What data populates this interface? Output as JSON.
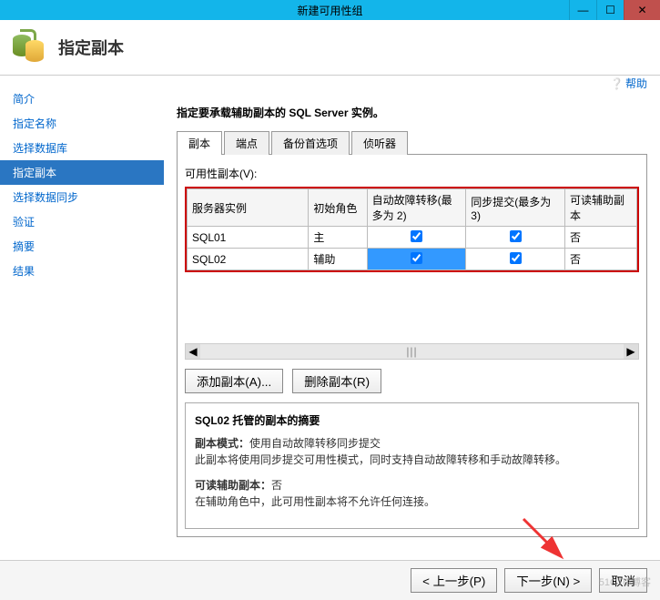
{
  "window": {
    "title": "新建可用性组"
  },
  "header": {
    "title": "指定副本"
  },
  "help": {
    "label": "帮助"
  },
  "nav": {
    "items": [
      {
        "label": "简介"
      },
      {
        "label": "指定名称"
      },
      {
        "label": "选择数据库"
      },
      {
        "label": "指定副本"
      },
      {
        "label": "选择数据同步"
      },
      {
        "label": "验证"
      },
      {
        "label": "摘要"
      },
      {
        "label": "结果"
      }
    ],
    "active_index": 3
  },
  "main": {
    "instruction": "指定要承载辅助副本的 SQL Server 实例。",
    "tabs": [
      {
        "label": "副本"
      },
      {
        "label": "端点"
      },
      {
        "label": "备份首选项"
      },
      {
        "label": "侦听器"
      }
    ],
    "active_tab": 0,
    "table_label": "可用性副本(V):",
    "columns": {
      "server_instance": "服务器实例",
      "initial_role": "初始角色",
      "auto_failover": "自动故障转移(最多为 2)",
      "sync_commit": "同步提交(最多为 3)",
      "readable": "可读辅助副本"
    },
    "rows": [
      {
        "server": "SQL01",
        "role": "主",
        "auto_failover": true,
        "sync_commit": true,
        "readable": "否"
      },
      {
        "server": "SQL02",
        "role": "辅助",
        "auto_failover": true,
        "sync_commit": true,
        "readable": "否"
      }
    ],
    "add_replica_label": "添加副本(A)...",
    "remove_replica_label": "删除副本(R)",
    "summary": {
      "title": "SQL02 托管的副本的摘要",
      "mode_label": "副本模式：",
      "mode_value": "使用自动故障转移同步提交",
      "mode_desc": "此副本将使用同步提交可用性模式，同时支持自动故障转移和手动故障转移。",
      "readable_label": "可读辅助副本：",
      "readable_value": "否",
      "readable_desc": "在辅助角色中，此可用性副本将不允许任何连接。"
    }
  },
  "footer": {
    "prev": "< 上一步(P)",
    "next": "下一步(N) >",
    "cancel": "取消"
  },
  "watermark": "51CTO博客"
}
